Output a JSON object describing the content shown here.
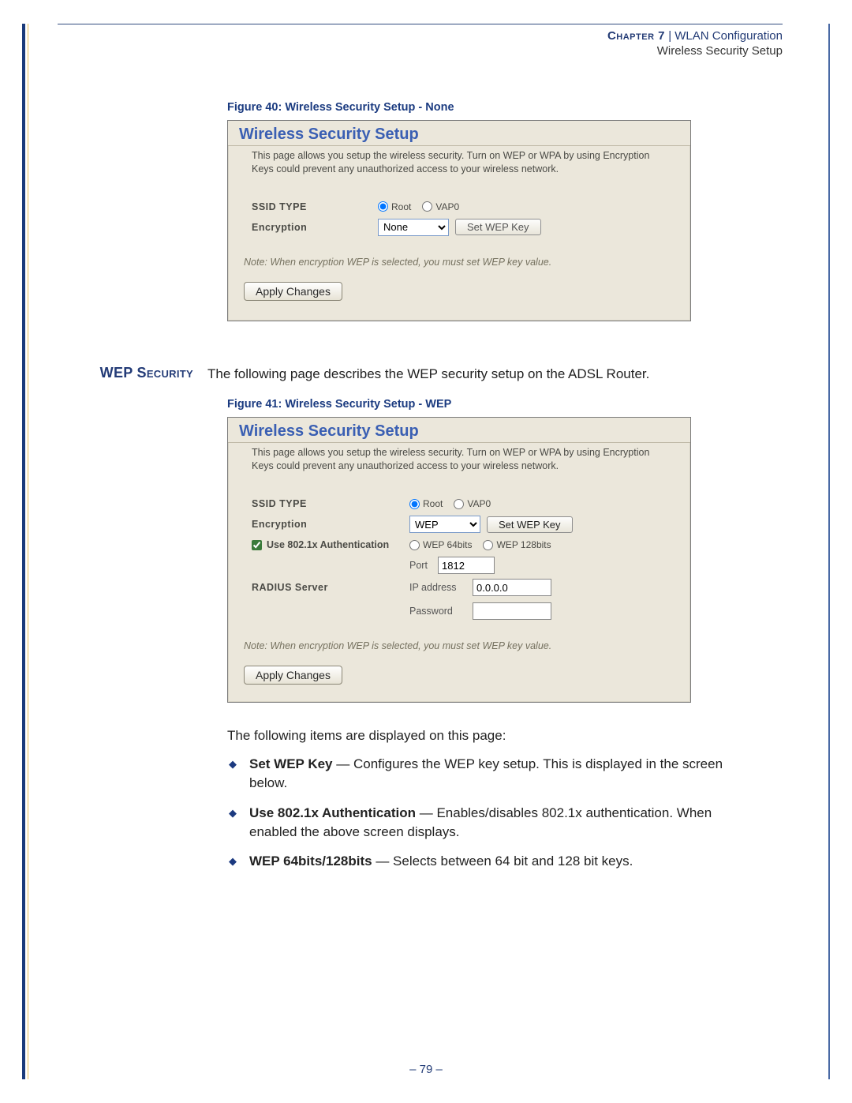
{
  "header": {
    "chapter_label": "Chapter 7",
    "sep": "  |  ",
    "chapter_title": "WLAN Configuration",
    "subtitle": "Wireless Security Setup"
  },
  "figure40": {
    "caption": "Figure 40:  Wireless Security Setup - None",
    "panel_title": "Wireless Security Setup",
    "desc": "This page allows you setup the wireless security. Turn on WEP or WPA by using Encryption Keys could prevent any unauthorized access to your wireless network.",
    "ssid_label": "SSID TYPE",
    "ssid_root": "Root",
    "ssid_vap0": "VAP0",
    "enc_label": "Encryption",
    "enc_value": "None",
    "setwep_btn": "Set WEP Key",
    "note": "Note: When encryption WEP is selected, you must set WEP key value.",
    "apply": "Apply Changes"
  },
  "wep_section": {
    "margin_title": "WEP Security",
    "intro": "The following page describes the WEP security setup on the ADSL Router."
  },
  "figure41": {
    "caption": "Figure 41:  Wireless Security Setup - WEP",
    "panel_title": "Wireless Security Setup",
    "desc": "This page allows you setup the wireless security. Turn on WEP or WPA by using Encryption Keys could prevent any unauthorized access to your wireless network.",
    "ssid_label": "SSID TYPE",
    "ssid_root": "Root",
    "ssid_vap0": "VAP0",
    "enc_label": "Encryption",
    "enc_value": "WEP",
    "setwep_btn": "Set WEP Key",
    "use8021x": "Use 802.1x Authentication",
    "wep64": "WEP 64bits",
    "wep128": "WEP 128bits",
    "port_label": "Port",
    "port_value": "1812",
    "radius_label": "RADIUS Server",
    "ip_label": "IP address",
    "ip_value": "0.0.0.0",
    "pw_label": "Password",
    "pw_value": "",
    "note": "Note: When encryption WEP is selected, you must set WEP key value.",
    "apply": "Apply Changes"
  },
  "items_intro": "The following items are displayed on this page:",
  "items": [
    {
      "term": "Set WEP Key",
      "rest": " — Configures the WEP key setup. This is displayed in the screen below."
    },
    {
      "term": "Use 802.1x Authentication",
      "rest": " — Enables/disables 802.1x authentication. When enabled the above screen displays."
    },
    {
      "term": "WEP 64bits/128bits",
      "rest": " — Selects between 64 bit and 128 bit keys."
    }
  ],
  "page_number": "–  79  –"
}
